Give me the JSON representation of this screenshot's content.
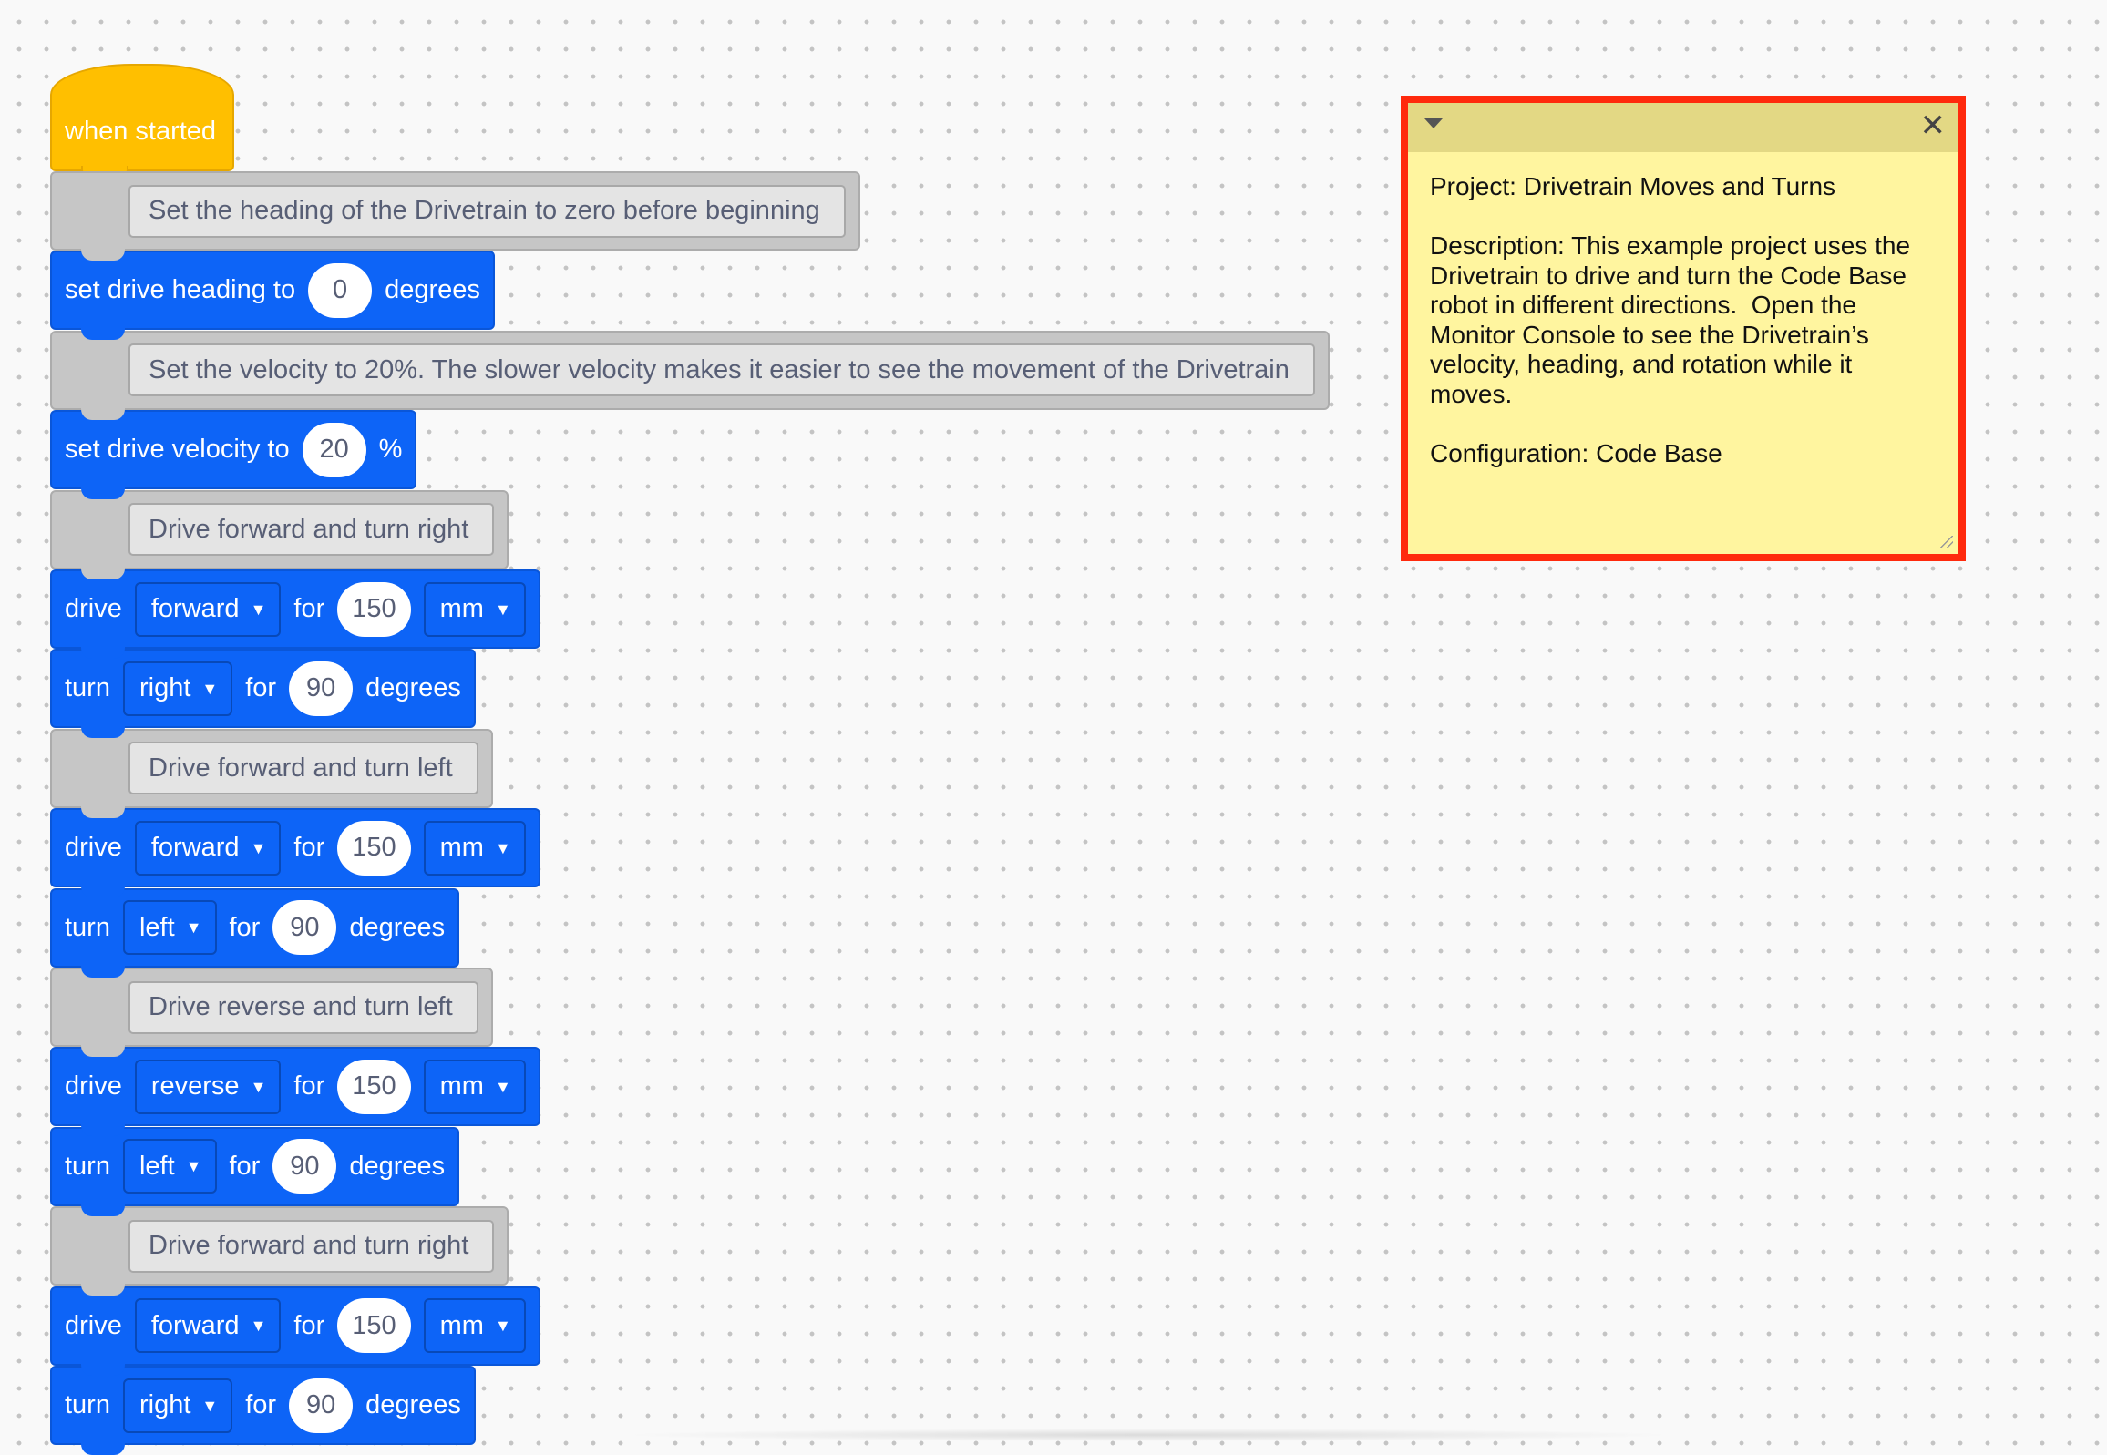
{
  "colors": {
    "event": "#ffbf00",
    "drivetrain": "#0d64f7",
    "comment_block": "#c6c6c6",
    "note_background": "#fff59f",
    "highlight_border": "#ff2a0d"
  },
  "hat": {
    "label": "when started"
  },
  "blocks": [
    {
      "type": "comment",
      "text": "Set the heading of the Drivetrain to zero before beginning"
    },
    {
      "type": "set_heading",
      "label": "set drive heading to",
      "value": "0",
      "unit": "degrees"
    },
    {
      "type": "comment",
      "text": "Set the velocity to 20%.  The slower velocity makes it easier to see the movement of the Drivetrain"
    },
    {
      "type": "set_velocity",
      "label": "set drive velocity to",
      "value": "20",
      "unit": "%"
    },
    {
      "type": "comment",
      "text": "Drive forward and turn right"
    },
    {
      "type": "drive",
      "label": "drive",
      "direction": "forward",
      "for_label": "for",
      "value": "150",
      "unit": "mm"
    },
    {
      "type": "turn",
      "label": "turn",
      "direction": "right",
      "for_label": "for",
      "value": "90",
      "unit": "degrees"
    },
    {
      "type": "comment",
      "text": "Drive forward and turn left"
    },
    {
      "type": "drive",
      "label": "drive",
      "direction": "forward",
      "for_label": "for",
      "value": "150",
      "unit": "mm"
    },
    {
      "type": "turn",
      "label": "turn",
      "direction": "left",
      "for_label": "for",
      "value": "90",
      "unit": "degrees"
    },
    {
      "type": "comment",
      "text": "Drive reverse and turn left"
    },
    {
      "type": "drive",
      "label": "drive",
      "direction": "reverse",
      "for_label": "for",
      "value": "150",
      "unit": "mm"
    },
    {
      "type": "turn",
      "label": "turn",
      "direction": "left",
      "for_label": "for",
      "value": "90",
      "unit": "degrees"
    },
    {
      "type": "comment",
      "text": "Drive forward and turn right"
    },
    {
      "type": "drive",
      "label": "drive",
      "direction": "forward",
      "for_label": "for",
      "value": "150",
      "unit": "mm"
    },
    {
      "type": "turn",
      "label": "turn",
      "direction": "right",
      "for_label": "for",
      "value": "90",
      "unit": "degrees"
    }
  ],
  "note": {
    "collapse_icon": "caret-down-icon",
    "close_icon": "close-icon",
    "close_glyph": "✕",
    "text": "Project: Drivetrain Moves and Turns\n\nDescription: This example project uses the Drivetrain to drive and turn the Code Base robot in different directions.  Open the Monitor Console to see the Drivetrain’s velocity, heading, and rotation while it moves.\n\nConfiguration: Code Base"
  }
}
